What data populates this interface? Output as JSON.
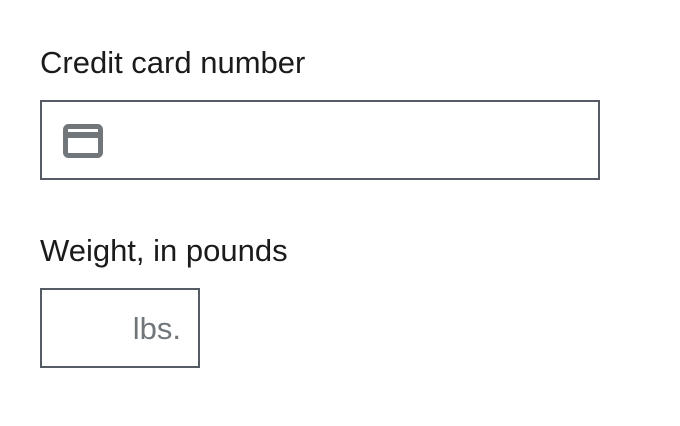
{
  "credit_card": {
    "label": "Credit card number",
    "value": "",
    "icon": "credit-card-icon"
  },
  "weight": {
    "label": "Weight, in pounds",
    "value": "",
    "suffix": "lbs."
  },
  "colors": {
    "text": "#1b1b1b",
    "border": "#565c65",
    "icon": "#71767a",
    "suffix": "#71767a"
  }
}
